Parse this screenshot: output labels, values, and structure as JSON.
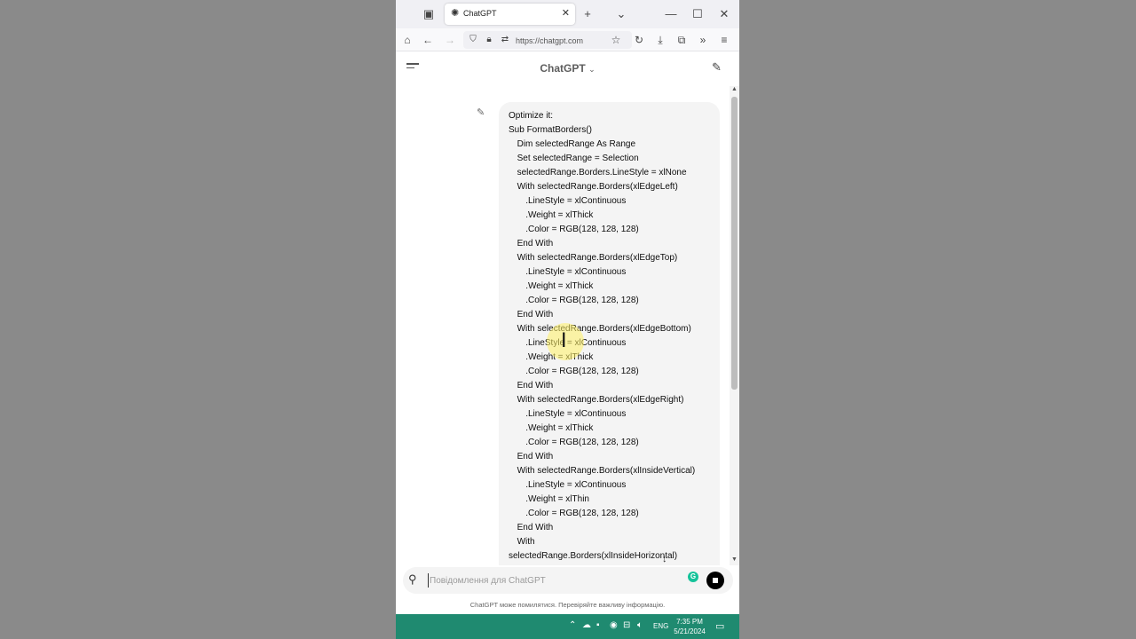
{
  "browser": {
    "tab_title": "ChatGPT",
    "url": "https://chatgpt.com"
  },
  "chat": {
    "title": "ChatGPT",
    "message_lines": [
      "Optimize it:",
      "Sub FormatBorders()",
      "    Dim selectedRange As Range",
      "    Set selectedRange = Selection",
      "    selectedRange.Borders.LineStyle = xlNone",
      "    With selectedRange.Borders(xlEdgeLeft)",
      "        .LineStyle = xlContinuous",
      "        .Weight = xlThick",
      "        .Color = RGB(128, 128, 128)",
      "    End With",
      "    With selectedRange.Borders(xlEdgeTop)",
      "        .LineStyle = xlContinuous",
      "        .Weight = xlThick",
      "        .Color = RGB(128, 128, 128)",
      "    End With",
      "    With selectedRange.Borders(xlEdgeBottom)",
      "        .LineStyle = xlContinuous",
      "        .Weight = xlThick",
      "        .Color = RGB(128, 128, 128)",
      "    End With",
      "    With selectedRange.Borders(xlEdgeRight)",
      "        .LineStyle = xlContinuous",
      "        .Weight = xlThick",
      "        .Color = RGB(128, 128, 128)",
      "    End With",
      "    With selectedRange.Borders(xlInsideVertical)",
      "        .LineStyle = xlContinuous",
      "        .Weight = xlThin",
      "        .Color = RGB(128, 128, 128)",
      "    End With",
      "    With",
      "selectedRange.Borders(xlInsideHorizontal)"
    ],
    "input_placeholder": "Повідомлення для ChatGPT",
    "input_value": "",
    "disclaimer": "ChatGPT може помилятися. Перевіряйте важливу інформацію."
  },
  "taskbar": {
    "language": "ENG",
    "time": "7:35 PM",
    "date": "5/21/2024"
  },
  "colors": {
    "taskbar": "#1f8a70",
    "bubble": "#f4f4f4",
    "page_bg": "#8a8a8a"
  }
}
